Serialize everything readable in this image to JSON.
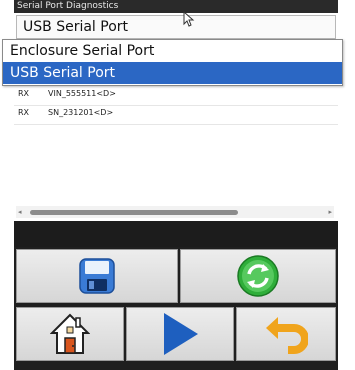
{
  "window": {
    "title": "Serial Port Diagnostics"
  },
  "port_select": {
    "value": "USB Serial Port",
    "options": [
      "Enclosure Serial Port",
      "USB Serial Port"
    ],
    "selected_index": 1
  },
  "log": {
    "rows": [
      {
        "dir": "RX",
        "text": "VIN_555511<D>"
      },
      {
        "dir": "RX",
        "text": "SN_231201<D>"
      }
    ]
  },
  "toolbar": {
    "row1": [
      "save-icon",
      "refresh-icon"
    ],
    "row2": [
      "home-icon",
      "play-icon",
      "undo-icon"
    ]
  },
  "colors": {
    "selection": "#2b67c4",
    "save_icon": "#3a7bd5",
    "refresh_icon": "#2fae3a",
    "play_icon": "#1e5fbf",
    "undo_icon": "#f0a41c",
    "house_door": "#d9561e"
  }
}
